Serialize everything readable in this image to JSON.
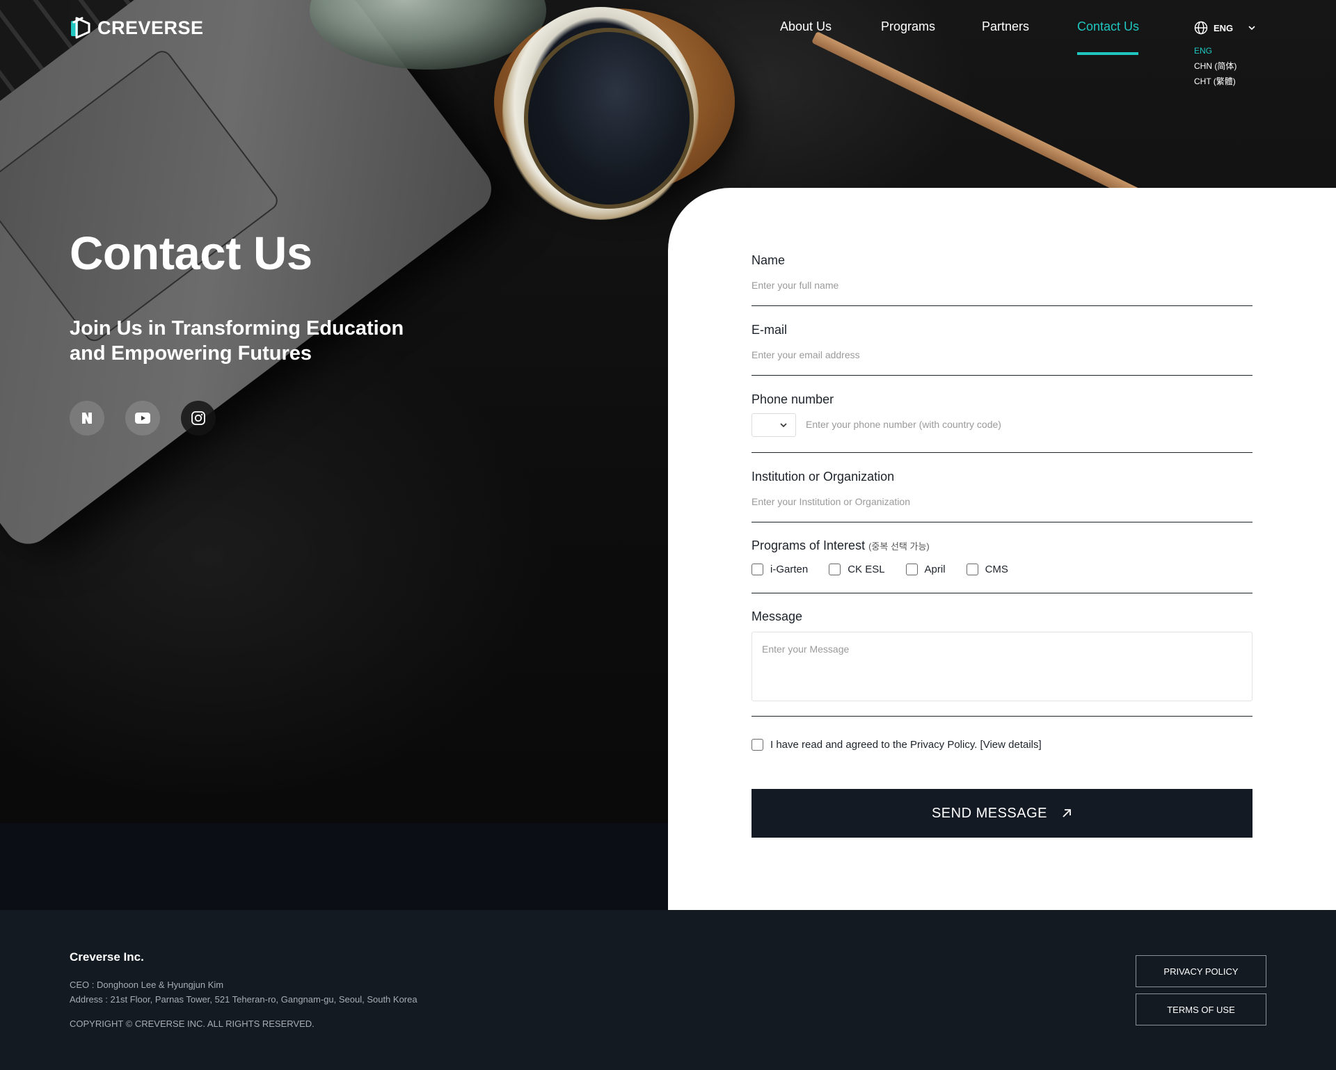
{
  "brand": {
    "name": "CREVERSE",
    "accent_color": "#1fc7c0",
    "logo_icon": "creverse-logo-icon"
  },
  "nav": {
    "items": [
      {
        "label": "About Us",
        "active": false
      },
      {
        "label": "Programs",
        "active": false
      },
      {
        "label": "Partners",
        "active": false
      },
      {
        "label": "Contact Us",
        "active": true
      }
    ]
  },
  "language": {
    "current": "ENG",
    "icon": "globe-icon",
    "options": [
      "ENG",
      "CHN (简体)",
      "CHT (繁體)"
    ]
  },
  "hero": {
    "title": "Contact Us",
    "subtitle_line1": "Join Us in Transforming Education",
    "subtitle_line2": "and Empowering Futures",
    "social": [
      "naver-blog-icon",
      "youtube-icon",
      "instagram-icon"
    ]
  },
  "form": {
    "name": {
      "label": "Name",
      "placeholder": "Enter your full name"
    },
    "email": {
      "label": "E-mail",
      "placeholder": "Enter your email address"
    },
    "phone": {
      "label": "Phone number",
      "placeholder": "Enter your phone number (with country code)"
    },
    "org": {
      "label": "Institution or Organization",
      "placeholder": "Enter your Institution or Organization"
    },
    "programs": {
      "label": "Programs of Interest",
      "note": "(중복 선택 가능)",
      "options": [
        "i-Garten",
        "CK ESL",
        "April",
        "CMS"
      ]
    },
    "message": {
      "label": "Message",
      "placeholder": "Enter your Message"
    },
    "privacy": "I have read and agreed to the Privacy Policy. [View details]",
    "submit": "SEND MESSAGE"
  },
  "footer": {
    "company": "Creverse Inc.",
    "ceo": "CEO : Donghoon Lee & Hyungjun Kim",
    "address": "Address : 21st Floor, Parnas Tower, 521 Teheran-ro, Gangnam-gu, Seoul, South Korea",
    "copyright": "COPYRIGHT © CREVERSE INC. ALL RIGHTS RESERVED.",
    "privacy_btn": "PRIVACY POLICY",
    "terms_btn": "TERMS OF USE"
  }
}
